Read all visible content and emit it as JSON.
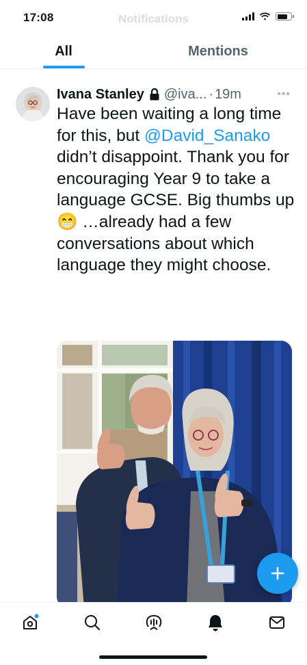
{
  "status_bar": {
    "time": "17:08",
    "icons": [
      "cellular-signal-icon",
      "wifi-icon",
      "battery-icon"
    ],
    "battery_level": 0.8
  },
  "header": {
    "title": "Notifications"
  },
  "tabs": [
    {
      "label": "All",
      "active": true
    },
    {
      "label": "Mentions",
      "active": false
    }
  ],
  "tweet": {
    "author": "Ivana Stanley",
    "protected_icon": "lock-icon",
    "handle": "@iva...",
    "separator": "·",
    "time": "19m",
    "more_icon": "more-dots-icon",
    "text_before": "Have been waiting a long time for this, but ",
    "mention": "@David_Sanako",
    "text_after": " didn’t disappoint. Thank you for encouraging Year 9 to take a language GCSE. Big thumbs up 😁 …already had a few conversations about which language they might choose.",
    "media": "photo"
  },
  "fab": {
    "icon": "plus-icon"
  },
  "bottom_nav": [
    {
      "icon": "home-icon",
      "has_badge": true
    },
    {
      "icon": "search-icon",
      "has_badge": false
    },
    {
      "icon": "spaces-icon",
      "has_badge": false
    },
    {
      "icon": "notifications-bell-icon",
      "active": true
    },
    {
      "icon": "messages-icon",
      "has_badge": false
    }
  ],
  "colors": {
    "accent": "#1d9bf0",
    "text": "#0f1419",
    "secondary": "#536471"
  }
}
